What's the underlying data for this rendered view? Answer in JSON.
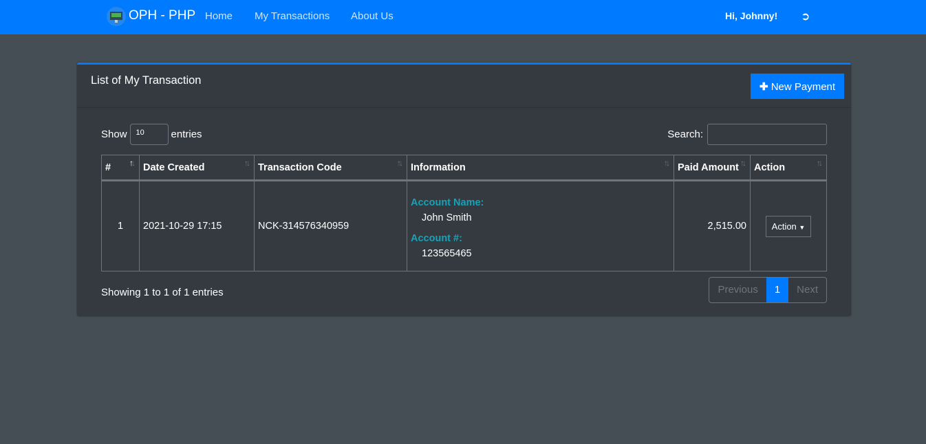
{
  "navbar": {
    "brand": "OPH - PHP",
    "links": [
      "Home",
      "My Transactions",
      "About Us"
    ],
    "greeting": "Hi, Johnny!",
    "logout_icon": "sign-out-icon",
    "color": "#007bff"
  },
  "card": {
    "title": "List of My Transaction",
    "new_button": "New Payment"
  },
  "controls": {
    "show_label": "Show",
    "entries_value": "10",
    "entries_label": "entries",
    "search_label": "Search:",
    "search_value": ""
  },
  "table": {
    "headers": [
      "#",
      "Date Created",
      "Transaction Code",
      "Information",
      "Paid Amount",
      "Action"
    ],
    "rows": [
      {
        "num": "1",
        "date": "2021-10-29 17:15",
        "code": "NCK-314576340959",
        "account_name_label": "Account Name:",
        "account_name": "John Smith",
        "account_no_label": "Account #:",
        "account_no": "123565465",
        "amount": "2,515.00",
        "action": "Action"
      }
    ]
  },
  "footer": {
    "info": "Showing 1 to 1 of 1 entries",
    "previous": "Previous",
    "page": "1",
    "next": "Next"
  }
}
